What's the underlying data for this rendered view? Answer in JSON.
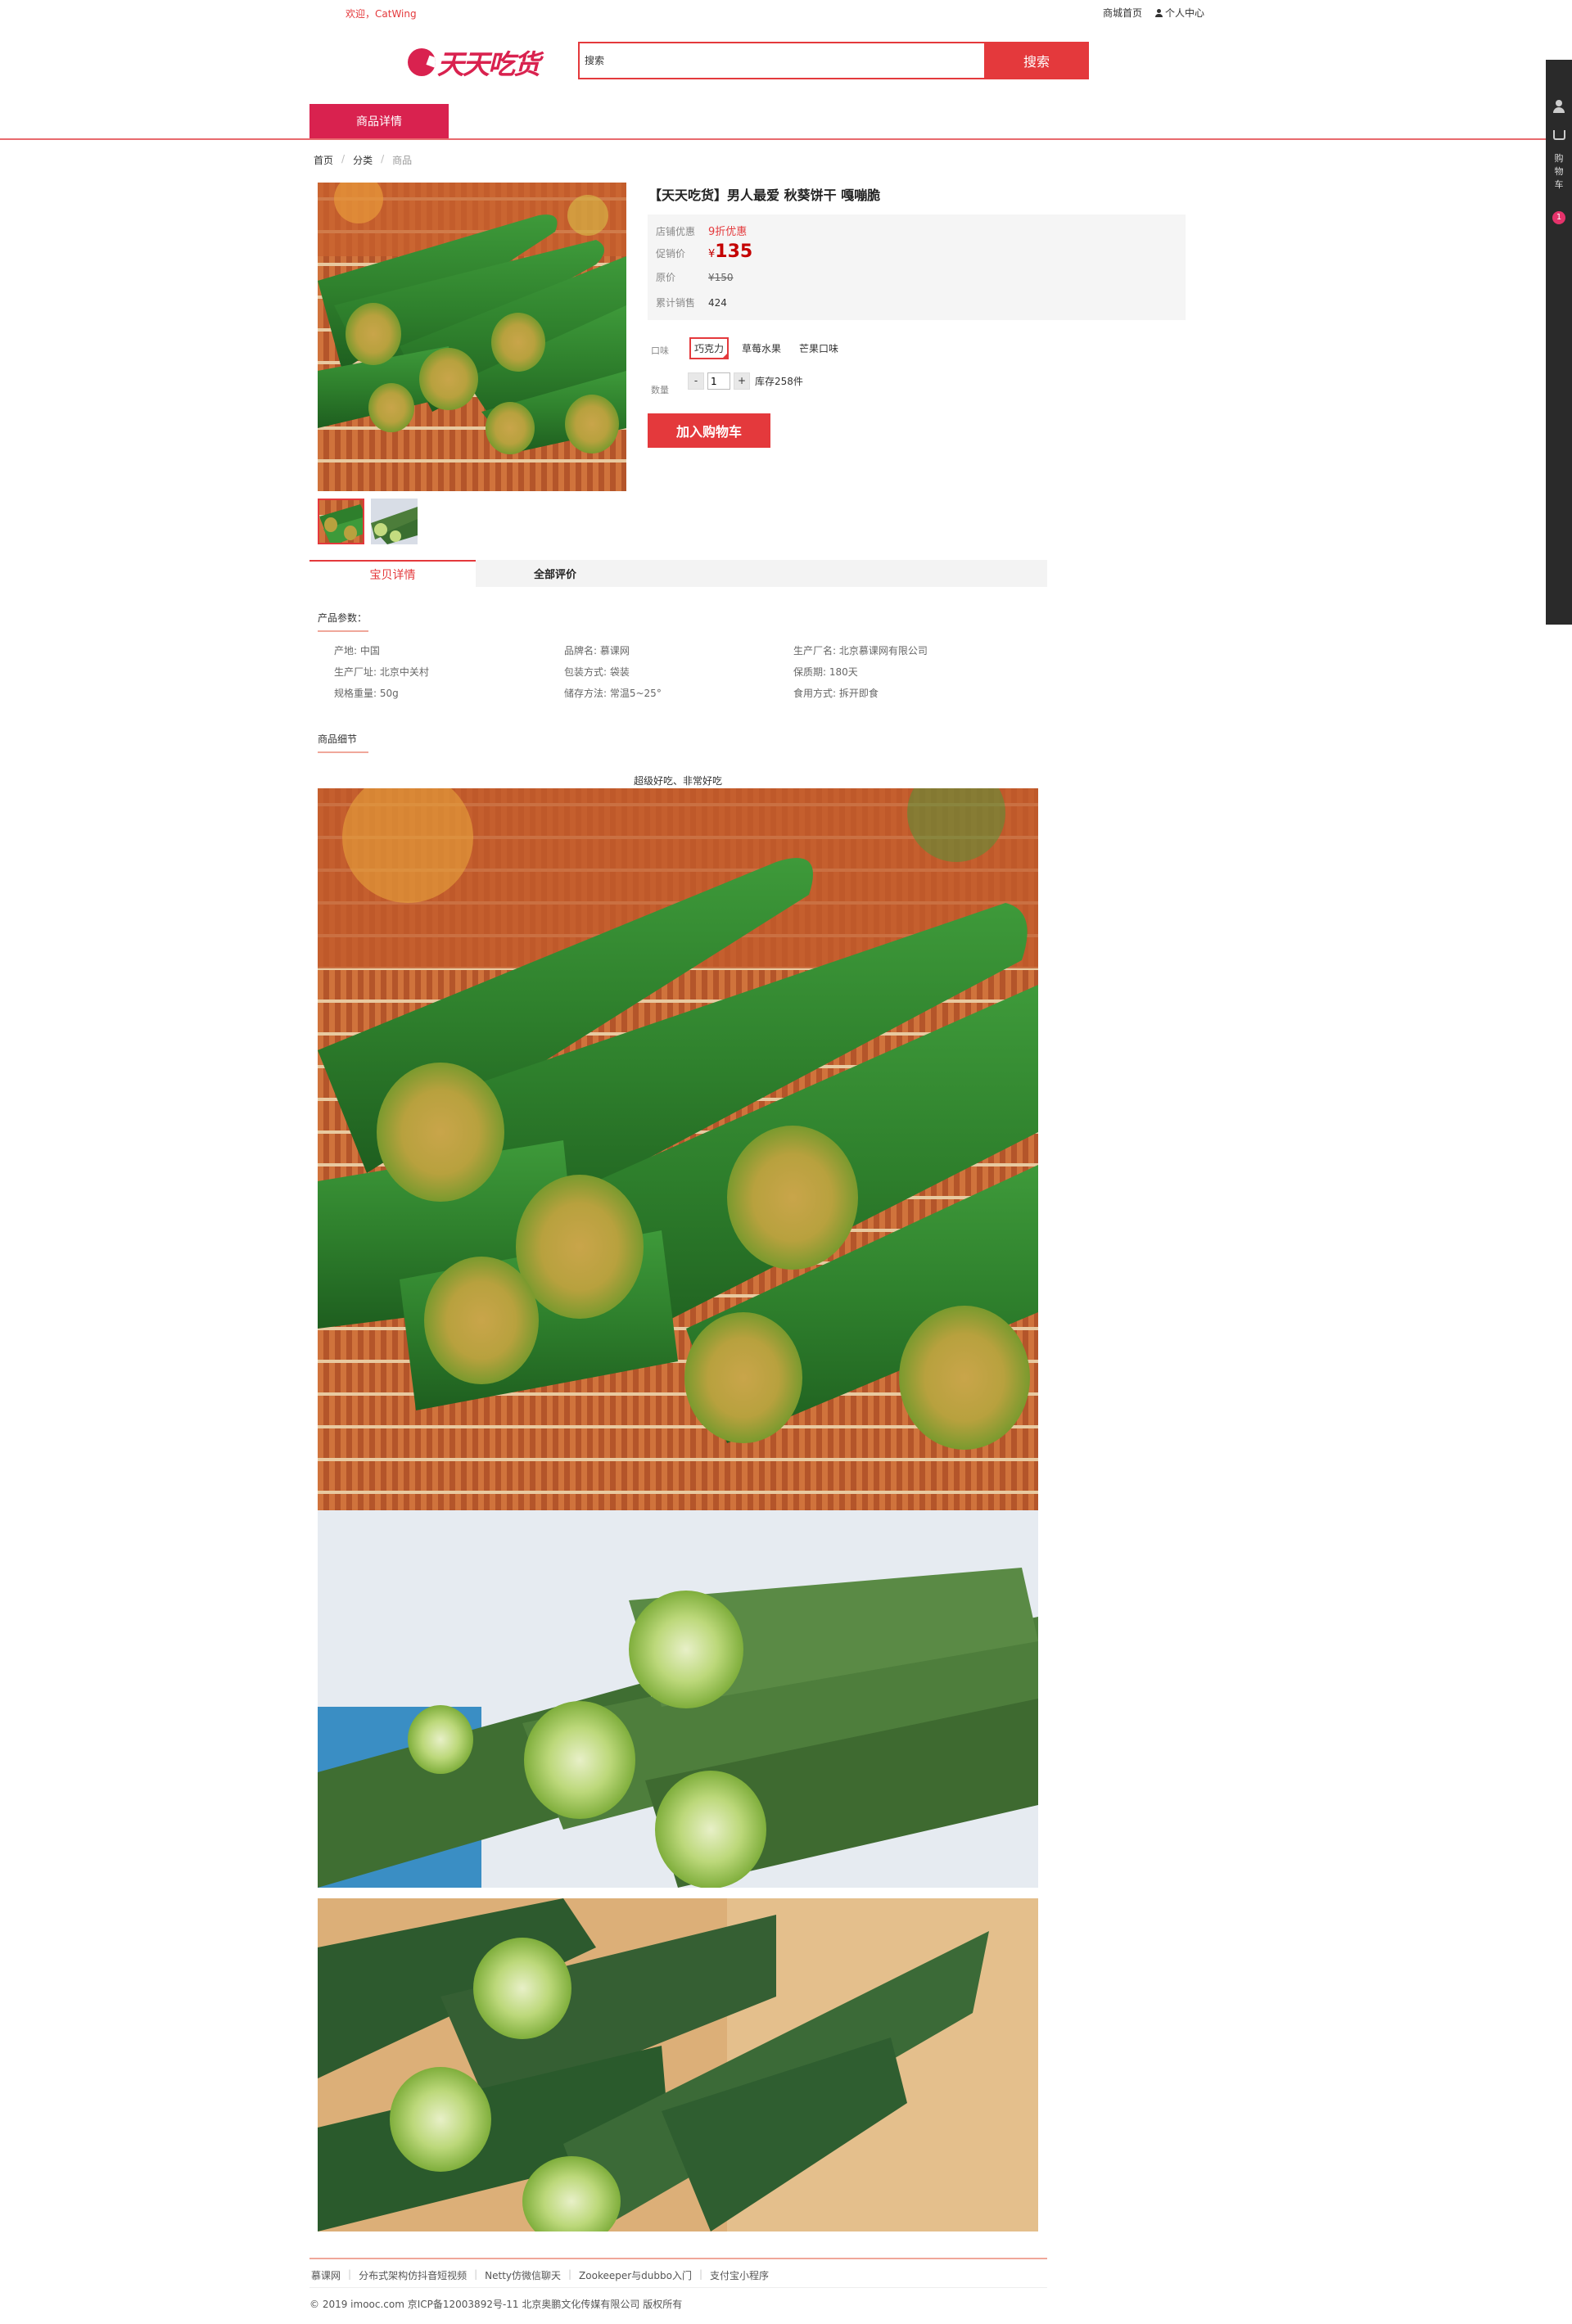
{
  "header": {
    "welcome": "欢迎，CatWing",
    "links": [
      "商城首页",
      "个人中心"
    ],
    "logo_text": "天天吃货",
    "search_placeholder": "搜索",
    "search_button": "搜索"
  },
  "nav": {
    "tab_label": "商品详情"
  },
  "sidebar": {
    "cart_label": "购物车",
    "cart_count": "1"
  },
  "breadcrumb": [
    "首页",
    "分类",
    "商品"
  ],
  "product": {
    "title": "【天天吃货】男人最爱 秋葵饼干 嘎嘣脆",
    "shop_discount_label": "店铺优惠",
    "shop_discount": "9折优惠",
    "promo_label": "促销价",
    "currency": "¥",
    "promo_price": "135",
    "orig_label": "原价",
    "orig_price": "¥150",
    "sold_label": "累计销售",
    "sold": "424",
    "flavor_label": "口味",
    "flavors": [
      "巧克力",
      "草莓水果",
      "芒果口味"
    ],
    "selected_flavor": "巧克力",
    "qty_label": "数量",
    "qty_minus": "-",
    "qty_value": "1",
    "qty_plus": "+",
    "stock": "库存258件",
    "add_to_cart": "加入购物车"
  },
  "tabs": [
    "宝贝详情",
    "全部评价"
  ],
  "params": {
    "section_title": "产品参数：",
    "items": [
      "产地: 中国",
      "品牌名: 慕课网",
      "生产厂名: 北京慕课网有限公司",
      "生产厂址: 北京中关村",
      "包装方式: 袋装",
      "保质期: 180天",
      "规格重量: 50g",
      "储存方法: 常温5~25°",
      "食用方式: 拆开即食"
    ]
  },
  "details": {
    "section_title": "商品细节",
    "caption": "超级好吃、非常好吃"
  },
  "footer": {
    "links": [
      "慕课网",
      "分布式架构仿抖音短视频",
      "Netty仿微信聊天",
      "Zookeeper与dubbo入门",
      "支付宝小程序"
    ],
    "copyright": "© 2019 imooc.com 京ICP备12003892号-11 北京奥鹏文化传媒有限公司 版权所有"
  }
}
